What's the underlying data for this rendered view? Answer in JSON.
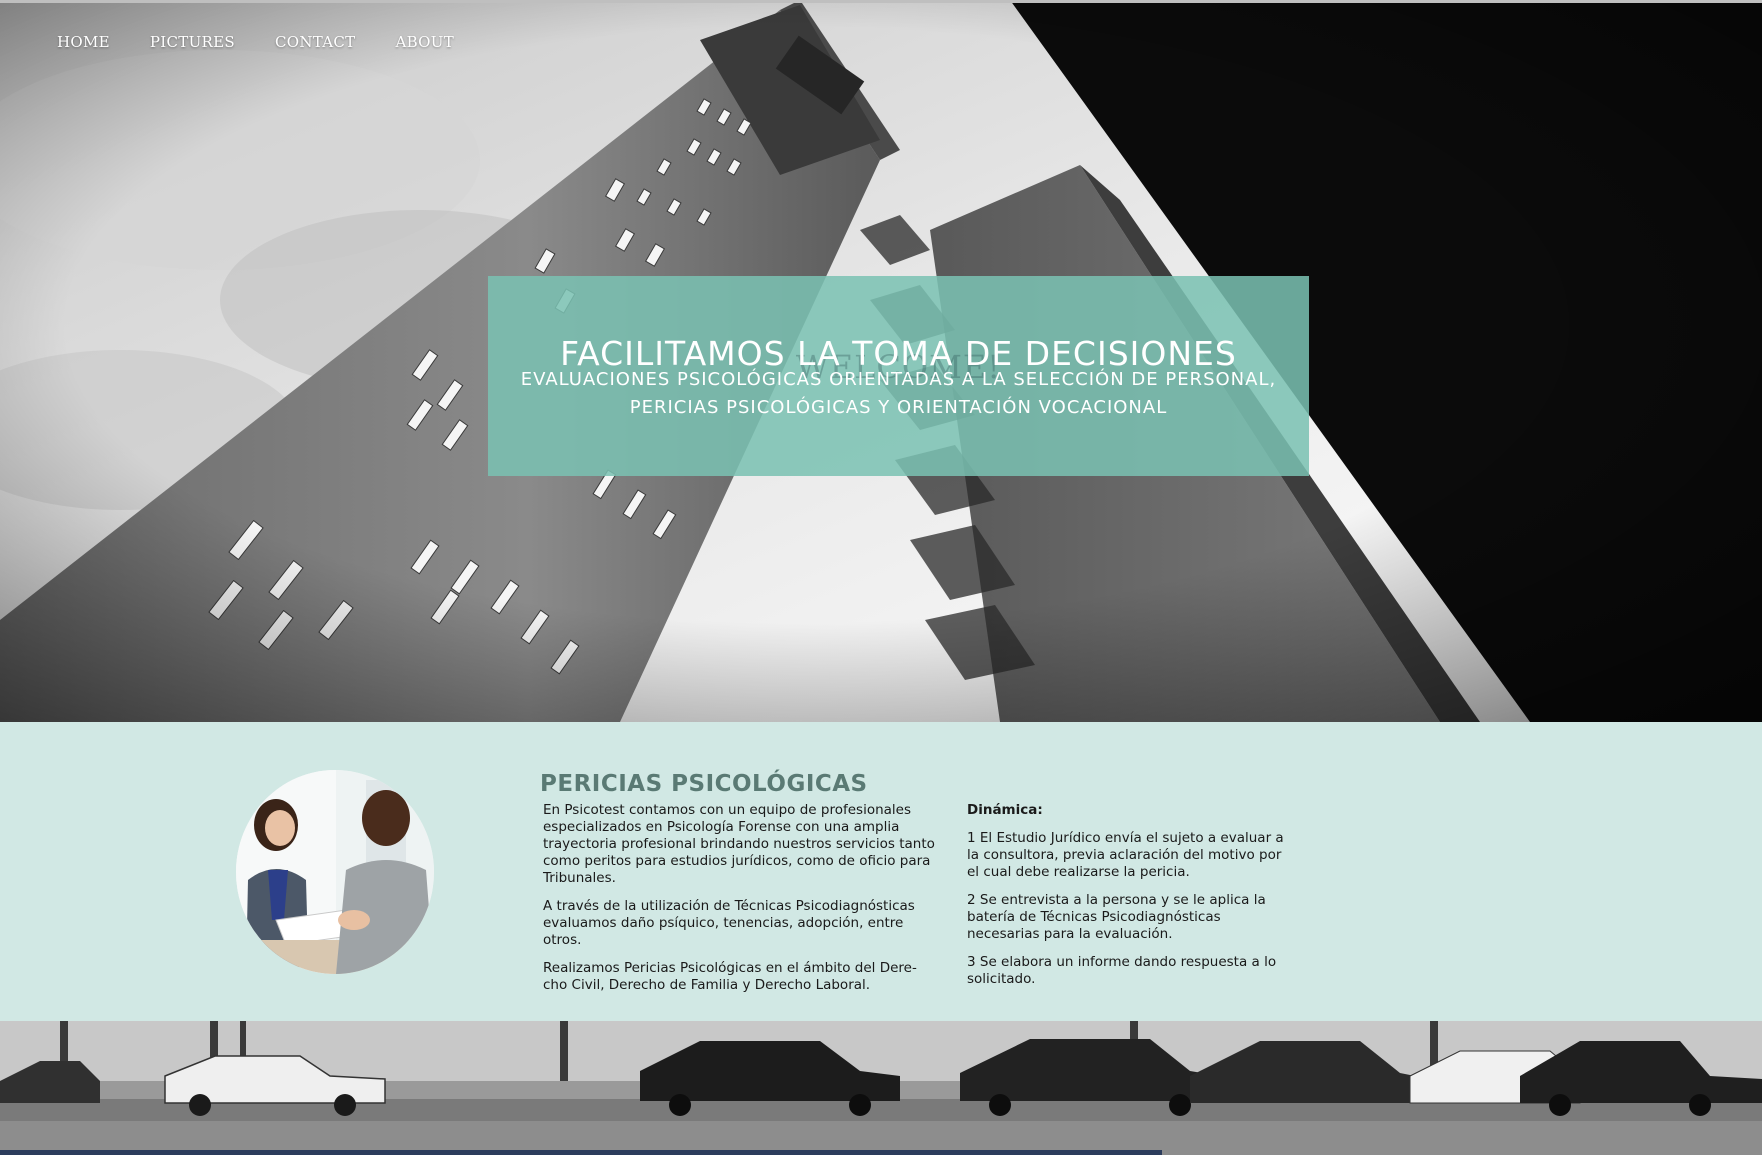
{
  "nav": {
    "items": [
      {
        "label": "HOME"
      },
      {
        "label": "PICTURES"
      },
      {
        "label": "CONTACT"
      },
      {
        "label": "ABOUT"
      }
    ]
  },
  "hero": {
    "welcome_text": "WELCOME!",
    "title": "FACILITAMOS LA TOMA DE DECISIONES",
    "subtitle_line1": "EVALUACIONES PSICOLÓGICAS ORIENTADAS A LA SELECCIÓN DE PERSONAL,",
    "subtitle_line2": "PERICIAS PSICOLÓGICAS Y ORIENTACIÓN VOCACIONAL",
    "box_color": "#7ac1b2"
  },
  "pericias": {
    "title": "PERICIAS PSICOLÓGICAS",
    "left_paragraphs": [
      "En Psicotest contamos con un equipo de profesionales especializados en Psicología Forense con una amplia trayectoria profesional brindando nuestros servicios tanto como peritos para estudios jurídicos, como de oficio para Tribunales.",
      "A través de la utilización de Técnicas Psicodiagnósticas evaluamos daño psíquico, tenencias, adopción, entre otros.",
      "Realizamos Pericias Psicológicas en el ámbito del Dere-cho Civil, Derecho de Familia y Derecho Laboral."
    ],
    "dynamics_heading": "Dinámica:",
    "dynamics_steps": [
      "1 El Estudio Jurídico envía el sujeto a evaluar a la consultora, previa aclaración del motivo por el cual debe realizarse la pericia.",
      "2 Se entrevista a la persona y se le aplica la batería de Técnicas Psicodiagnósticas necesarias para la evaluación.",
      "3 Se elabora un informe dando respuesta a lo solicitado."
    ],
    "background_color": "#d1e8e4",
    "title_color": "#5a7a74"
  }
}
